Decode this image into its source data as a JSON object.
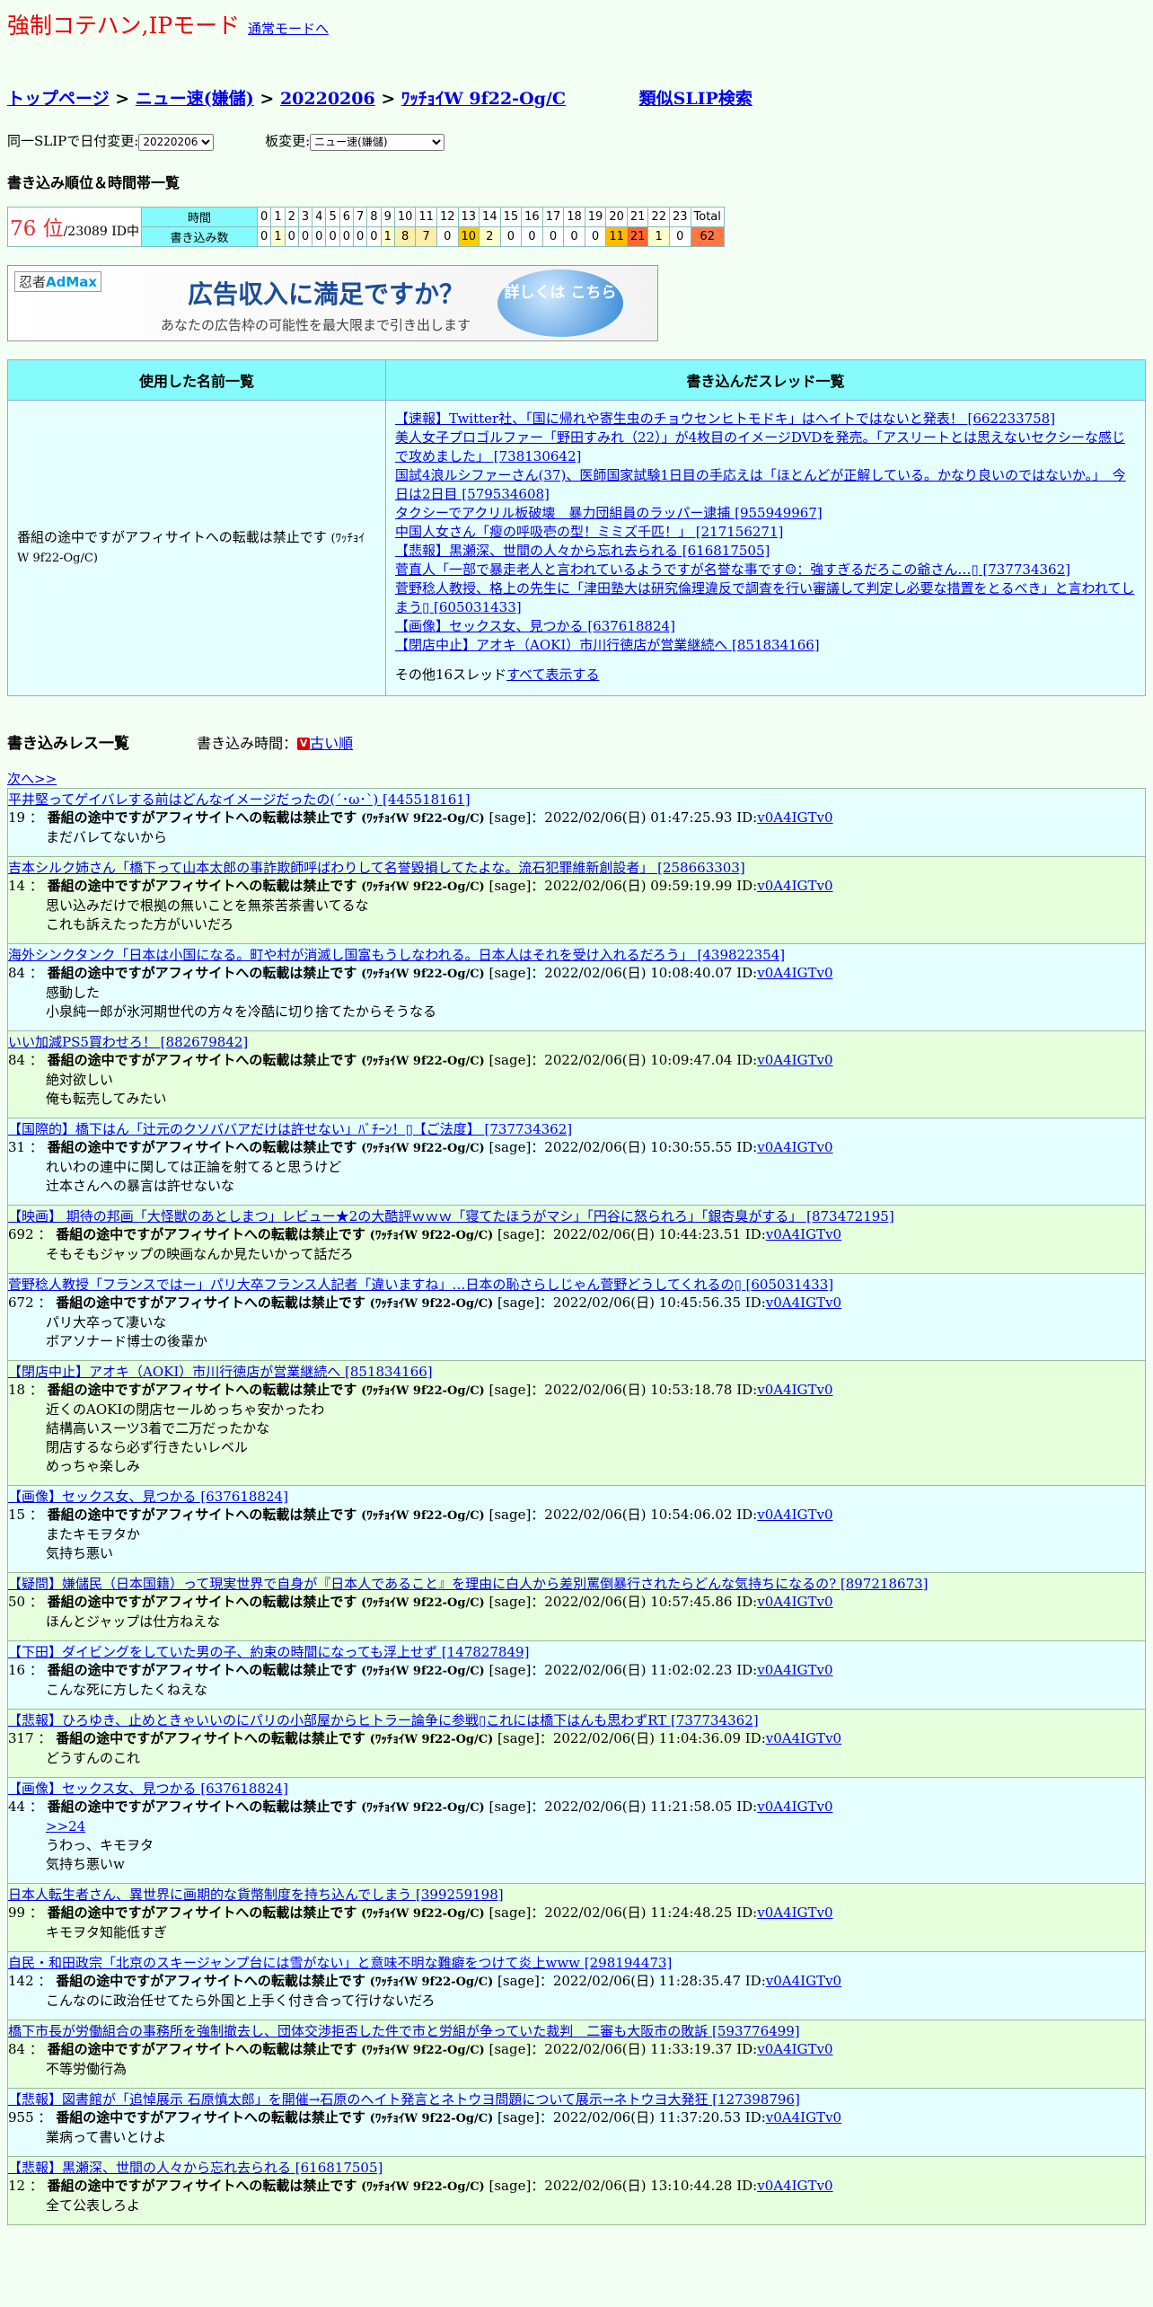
{
  "header": {
    "mode_title": "強制コテハン,IPモード",
    "mode_link": "通常モードへ"
  },
  "breadcrumb": {
    "items": [
      "トップページ",
      "ニュー速(嫌儲)",
      "20220206",
      "ﾜｯﾁｮｲW 9f22-Og/C"
    ],
    "separator": ">",
    "similar_search": "類似SLIP検索"
  },
  "selectors": {
    "date_label": "同一SLIPで日付変更:",
    "date_value": "20220206",
    "board_label": "板変更:",
    "board_value": "ニュー速(嫌儲)"
  },
  "ranking": {
    "heading": "書き込み順位＆時間帯一覧",
    "rank": "76 位",
    "total_ids": "/23089 ID中",
    "time_label": "時間",
    "count_label": "書き込み数",
    "hours": [
      "0",
      "1",
      "2",
      "3",
      "4",
      "5",
      "6",
      "7",
      "8",
      "9",
      "10",
      "11",
      "12",
      "13",
      "14",
      "15",
      "16",
      "17",
      "18",
      "19",
      "20",
      "21",
      "22",
      "23",
      "Total"
    ],
    "counts": [
      "0",
      "1",
      "0",
      "0",
      "0",
      "0",
      "0",
      "0",
      "0",
      "1",
      "8",
      "7",
      "0",
      "10",
      "2",
      "0",
      "0",
      "0",
      "0",
      "0",
      "11",
      "21",
      "1",
      "0",
      "62"
    ],
    "count_colors": [
      "#ffffff",
      "#ffffcc",
      "#ffffff",
      "#ffffff",
      "#ffffff",
      "#ffffff",
      "#ffffff",
      "#ffffff",
      "#ffffff",
      "#ffffcc",
      "#ffeeaa",
      "#ffeeaa",
      "#ffffff",
      "#ffcc00",
      "#ffffcc",
      "#ffffff",
      "#ffffff",
      "#ffffff",
      "#ffffff",
      "#ffffff",
      "#ffbb00",
      "#ff6633",
      "#ffffcc",
      "#ffffff",
      "#ff7744"
    ]
  },
  "ad": {
    "logo_prefix": "忍者",
    "logo_name": "AdMax",
    "headline": "広告収入に満足ですか？",
    "sub": "あなたの広告枠の可能性を最大限まで引き出します",
    "button": "詳しくは こちら"
  },
  "names_table": {
    "col_names": "使用した名前一覧",
    "col_threads": "書き込んだスレッド一覧",
    "name": "番組の途中ですがアフィサイトへの転載は禁止です",
    "trip": "(ﾜｯﾁｮｲW 9f22-Og/C)",
    "threads": [
      "【速報】Twitter社、「国に帰れや寄生虫のチョウセンヒトモドキ」はヘイトではないと発表！ [662233758]",
      "美人女子プロゴルファー「野田すみれ（22）」が4枚目のイメージDVDを発売。「アスリートとは思えないセクシーな感じで攻めました」 [738130642]",
      "国試4浪ルシファーさん(37)、医師国家試験1日目の手応えは「ほとんどが正解している。かなり良いのではないか。」　今日は2日目 [579534608]",
      "タクシーでアクリル板破壊　暴力団組員のラッパー逮捕 [955949967]",
      "中国人女さん「瘦の呼吸壱の型！ミミズ千匹！」 [217156271]",
      "【悲報】黒瀬深、世間の人々から忘れ去られる [616817505]",
      "菅直人「一部で暴走老人と言われているようですが名誉な事です☺：強すぎるだろこの爺さん…▯ [737734362]",
      "菅野稔人教授、格上の先生に「津田塾大は研究倫理違反で調査を行い審議して判定し必要な措置をとるべき」と言われてしまう▯ [605031433]",
      "【画像】セックス女、見つかる [637618824]",
      "【閉店中止】アオキ（AOKI）市川行徳店が営業継続へ [851834166]"
    ],
    "other_prefix": "その他16スレッド",
    "other_link": "すべて表示する"
  },
  "posts_header": {
    "title": "書き込みレス一覧",
    "order_label": "書き込み時間：",
    "order_icon": "V",
    "order_link": "古い順",
    "next": "次へ>>"
  },
  "posts": [
    {
      "thread": "平井堅ってゲイバレする前はどんなイメージだったの(´･ω･`) [445518161]",
      "num": "19",
      "date": "[sage]：2022/02/06(日) 01:47:25.93 ID:",
      "id": "v0A4IGTv0",
      "body": [
        "まだバレてないから"
      ]
    },
    {
      "thread": "吉本シルク姉さん「橋下って山本太郎の事詐欺師呼ばわりして名誉毀損してたよな。流石犯罪維新創設者」 [258663303]",
      "num": "14",
      "date": "[sage]：2022/02/06(日) 09:59:19.99 ID:",
      "id": "v0A4IGTv0",
      "body": [
        "思い込みだけで根拠の無いことを無茶苦茶書いてるな",
        "これも訴えたった方がいいだろ"
      ]
    },
    {
      "thread": "海外シンクタンク「日本は小国になる。町や村が消滅し国富もうしなわれる。日本人はそれを受け入れるだろう」 [439822354]",
      "num": "84",
      "date": "[sage]：2022/02/06(日) 10:08:40.07 ID:",
      "id": "v0A4IGTv0",
      "body": [
        "感動した",
        "小泉純一郎が氷河期世代の方々を冷酷に切り捨てたからそうなる"
      ]
    },
    {
      "thread": "いい加減PS5買わせろ！ [882679842]",
      "num": "84",
      "date": "[sage]：2022/02/06(日) 10:09:47.04 ID:",
      "id": "v0A4IGTv0",
      "body": [
        "絶対欲しい",
        "俺も転売してみたい"
      ]
    },
    {
      "thread": "【国際的】橋下はん「辻元のクソババアだけは許せない」ﾊﾞﾁｰﾝ！▯【ご法度】 [737734362]",
      "num": "31",
      "date": "[sage]：2022/02/06(日) 10:30:55.55 ID:",
      "id": "v0A4IGTv0",
      "body": [
        "れいわの連中に関しては正論を射てると思うけど",
        "辻本さんへの暴言は許せないな"
      ]
    },
    {
      "thread": "【映画】 期待の邦画「大怪獣のあとしまつ」レビュー★2の大酷評ｗｗｗ「寝てたほうがマシ」「円谷に怒られろ」「銀杏臭がする」 [873472195]",
      "num": "692",
      "date": "[sage]：2022/02/06(日) 10:44:23.51 ID:",
      "id": "v0A4IGTv0",
      "body": [
        "そもそもジャップの映画なんか見たいかって話だろ"
      ]
    },
    {
      "thread": "菅野稔人教授「フランスではー」パリ大卒フランス人記者「違いますね」…日本の恥さらしじゃん菅野どうしてくれるの▯ [605031433]",
      "num": "672",
      "date": "[sage]：2022/02/06(日) 10:45:56.35 ID:",
      "id": "v0A4IGTv0",
      "body": [
        "パリ大卒って凄いな",
        "ボアソナード博士の後輩か"
      ]
    },
    {
      "thread": "【閉店中止】アオキ（AOKI）市川行徳店が営業継続へ [851834166]",
      "num": "18",
      "date": "[sage]：2022/02/06(日) 10:53:18.78 ID:",
      "id": "v0A4IGTv0",
      "body": [
        "近くのAOKIの閉店セールめっちゃ安かったわ",
        "結構高いスーツ3着で二万だったかな",
        "閉店するなら必ず行きたいレベル",
        "めっちゃ楽しみ"
      ]
    },
    {
      "thread": "【画像】セックス女、見つかる [637618824]",
      "num": "15",
      "date": "[sage]：2022/02/06(日) 10:54:06.02 ID:",
      "id": "v0A4IGTv0",
      "body": [
        "またキモヲタか",
        "気持ち悪い"
      ]
    },
    {
      "thread": "【疑問】嫌儲民（日本国籍）って現実世界で自身が『日本人であること』を理由に白人から差別罵倒暴行されたらどんな気持ちになるの? [897218673]",
      "num": "50",
      "date": "[sage]：2022/02/06(日) 10:57:45.86 ID:",
      "id": "v0A4IGTv0",
      "body": [
        "ほんとジャップは仕方ねえな"
      ]
    },
    {
      "thread": "【下田】ダイビングをしていた男の子、約束の時間になっても浮上せず [147827849]",
      "num": "16",
      "date": "[sage]：2022/02/06(日) 11:02:02.23 ID:",
      "id": "v0A4IGTv0",
      "body": [
        "こんな死に方したくねえな"
      ]
    },
    {
      "thread": "【悲報】ひろゆき、止めときゃいいのにパリの小部屋からヒトラー論争に参戦▯これには橋下はんも思わずRT [737734362]",
      "num": "317",
      "date": "[sage]：2022/02/06(日) 11:04:36.09 ID:",
      "id": "v0A4IGTv0",
      "body": [
        "どうすんのこれ"
      ]
    },
    {
      "thread": "【画像】セックス女、見つかる [637618824]",
      "num": "44",
      "date": "[sage]：2022/02/06(日) 11:21:58.05 ID:",
      "id": "v0A4IGTv0",
      "link": ">>24",
      "body": [
        "うわっ、キモヲタ",
        "気持ち悪いw"
      ]
    },
    {
      "thread": "日本人転生者さん、異世界に画期的な貨幣制度を持ち込んでしまう [399259198]",
      "num": "99",
      "date": "[sage]：2022/02/06(日) 11:24:48.25 ID:",
      "id": "v0A4IGTv0",
      "body": [
        "キモヲタ知能低すぎ"
      ]
    },
    {
      "thread": "自民・和田政宗「北京のスキージャンプ台には雪がない」と意味不明な難癖をつけて炎上www [298194473]",
      "num": "142",
      "date": "[sage]：2022/02/06(日) 11:28:35.47 ID:",
      "id": "v0A4IGTv0",
      "body": [
        "こんなのに政治任せてたら外国と上手く付き合って行けないだろ"
      ]
    },
    {
      "thread": "橋下市長が労働組合の事務所を強制撤去し、団体交渉拒否した件で市と労組が争っていた裁判　二審も大阪市の敗訴 [593776499]",
      "num": "84",
      "date": "[sage]：2022/02/06(日) 11:33:19.37 ID:",
      "id": "v0A4IGTv0",
      "body": [
        "不等労働行為"
      ]
    },
    {
      "thread": "【悲報】図書館が「追悼展示 石原慎太郎」を開催→石原のヘイト発言とネトウヨ問題について展示→ネトウヨ大発狂 [127398796]",
      "num": "955",
      "date": "[sage]：2022/02/06(日) 11:37:20.53 ID:",
      "id": "v0A4IGTv0",
      "body": [
        "業病って書いとけよ"
      ]
    },
    {
      "thread": "【悲報】黒瀬深、世間の人々から忘れ去られる [616817505]",
      "num": "12",
      "date": "[sage]：2022/02/06(日) 13:10:44.28 ID:",
      "id": "v0A4IGTv0",
      "body": [
        "全て公表しろよ"
      ]
    }
  ]
}
